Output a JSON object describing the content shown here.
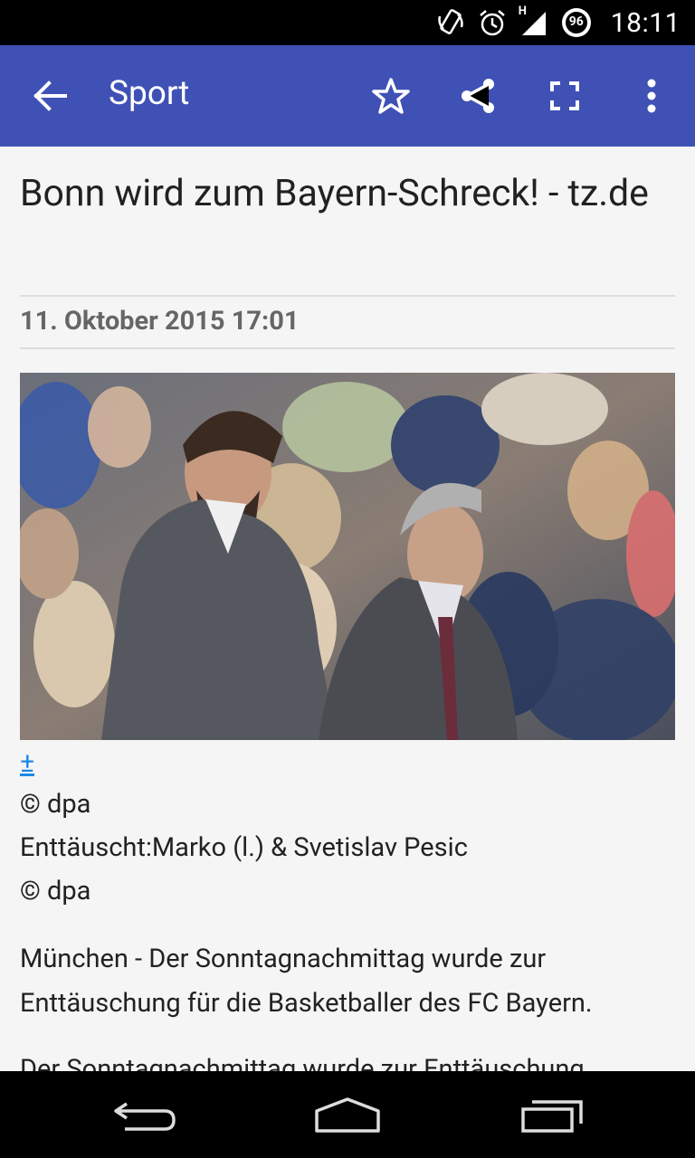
{
  "status_bar": {
    "time": "18:11",
    "battery_level": "96",
    "network_label": "H",
    "icons": [
      "rotate-icon",
      "alarm-icon",
      "signal-icon",
      "battery-icon"
    ]
  },
  "app_bar": {
    "title": "Sport",
    "color": "#3f51b5",
    "icons": [
      "back-arrow-icon",
      "star-icon",
      "share-icon",
      "fullscreen-icon",
      "more-vert-icon"
    ]
  },
  "article": {
    "headline": "Bonn wird zum Bayern-Schreck! - tz.de",
    "date": "11. Oktober 2015 17:01",
    "expand_link": "±",
    "captions": [
      "© dpa",
      "Enttäuscht:Marko (l.) & Svetislav Pesic",
      "© dpa"
    ],
    "paragraphs": [
      "München - Der Sonntagnachmittag wurde zur Enttäuschung für die Basketballer des FC Bayern.",
      "Der Sonntagnachmittag wurde zur Enttäuschung"
    ]
  },
  "nav_bar": {
    "icons": [
      "back-nav-icon",
      "home-nav-icon",
      "recents-nav-icon"
    ]
  }
}
